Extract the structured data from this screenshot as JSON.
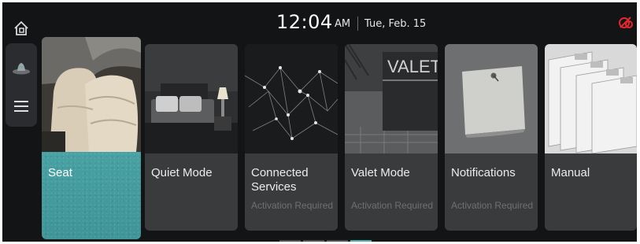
{
  "status_bar": {
    "time": "12:04",
    "ampm": "AM",
    "date": "Tue, Feb. 15",
    "status_icon": "connectivity-off-icon",
    "status_color": "#e0282d"
  },
  "rail": {
    "items": [
      {
        "icon": "home-icon"
      },
      {
        "icon": "vehicle-icon"
      },
      {
        "icon": "menu-icon"
      }
    ]
  },
  "cards": [
    {
      "title": "Seat",
      "subtitle": "",
      "image": "car-seat-photo"
    },
    {
      "title": "Quiet Mode",
      "subtitle": "",
      "image": "bedroom-photo"
    },
    {
      "title": "Connected Services",
      "subtitle": "Activation Required",
      "image": "network-photo"
    },
    {
      "title": "Valet Mode",
      "subtitle": "Activation Required",
      "image": "valet-sign-photo"
    },
    {
      "title": "Notifications",
      "subtitle": "Activation Required",
      "image": "sticky-note-photo"
    },
    {
      "title": "Manual",
      "subtitle": "",
      "image": "files-photo"
    }
  ],
  "pager": {
    "pages": 4,
    "current": 4
  },
  "colors": {
    "accent": "#4fb0b0",
    "background": "#131415",
    "card": "#3a3b3d"
  }
}
